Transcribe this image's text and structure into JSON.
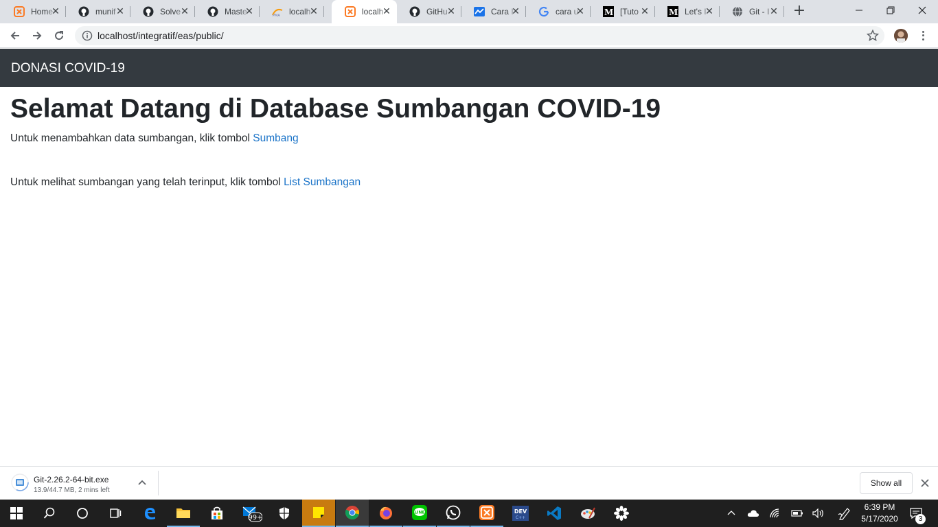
{
  "browser": {
    "tabs": [
      {
        "title": "Home",
        "icon": "xampp-icon"
      },
      {
        "title": "munif",
        "icon": "github-icon"
      },
      {
        "title": "Solve",
        "icon": "github-icon"
      },
      {
        "title": "Maste",
        "icon": "github-icon"
      },
      {
        "title": "localh",
        "icon": "phpmyadmin-icon"
      },
      {
        "title": "localh",
        "icon": "xampp-icon",
        "active": true
      },
      {
        "title": "GitHu",
        "icon": "github-icon"
      },
      {
        "title": "Cara I",
        "icon": "chart-site-icon"
      },
      {
        "title": "cara u",
        "icon": "google-icon"
      },
      {
        "title": "[Tuto",
        "icon": "medium-icon"
      },
      {
        "title": "Let's I",
        "icon": "medium-icon"
      },
      {
        "title": "Git - I",
        "icon": "globe-icon"
      }
    ],
    "url": "localhost/integratif/eas/public/"
  },
  "page": {
    "brand": "DONASI COVID-19",
    "heading": "Selamat Datang di Database Sumbangan COVID-19",
    "para1_text": "Untuk menambahkan data sumbangan, klik tombol ",
    "para1_link": "Sumbang",
    "para2_text": "Untuk melihat sumbangan yang telah terinput, klik tombol ",
    "para2_link": "List Sumbangan"
  },
  "download": {
    "filename": "Git-2.26.2-64-bit.exe",
    "status": "13.9/44.7 MB, 2 mins left",
    "show_all": "Show all"
  },
  "taskbar": {
    "time": "6:39 PM",
    "date": "5/17/2020",
    "mail_badge": "99+",
    "notification_count": "3"
  },
  "colors": {
    "navbar": "#343a40",
    "link": "#1a73c8",
    "tabstrip": "#dee1e6",
    "taskbar": "#1f1f1f"
  }
}
